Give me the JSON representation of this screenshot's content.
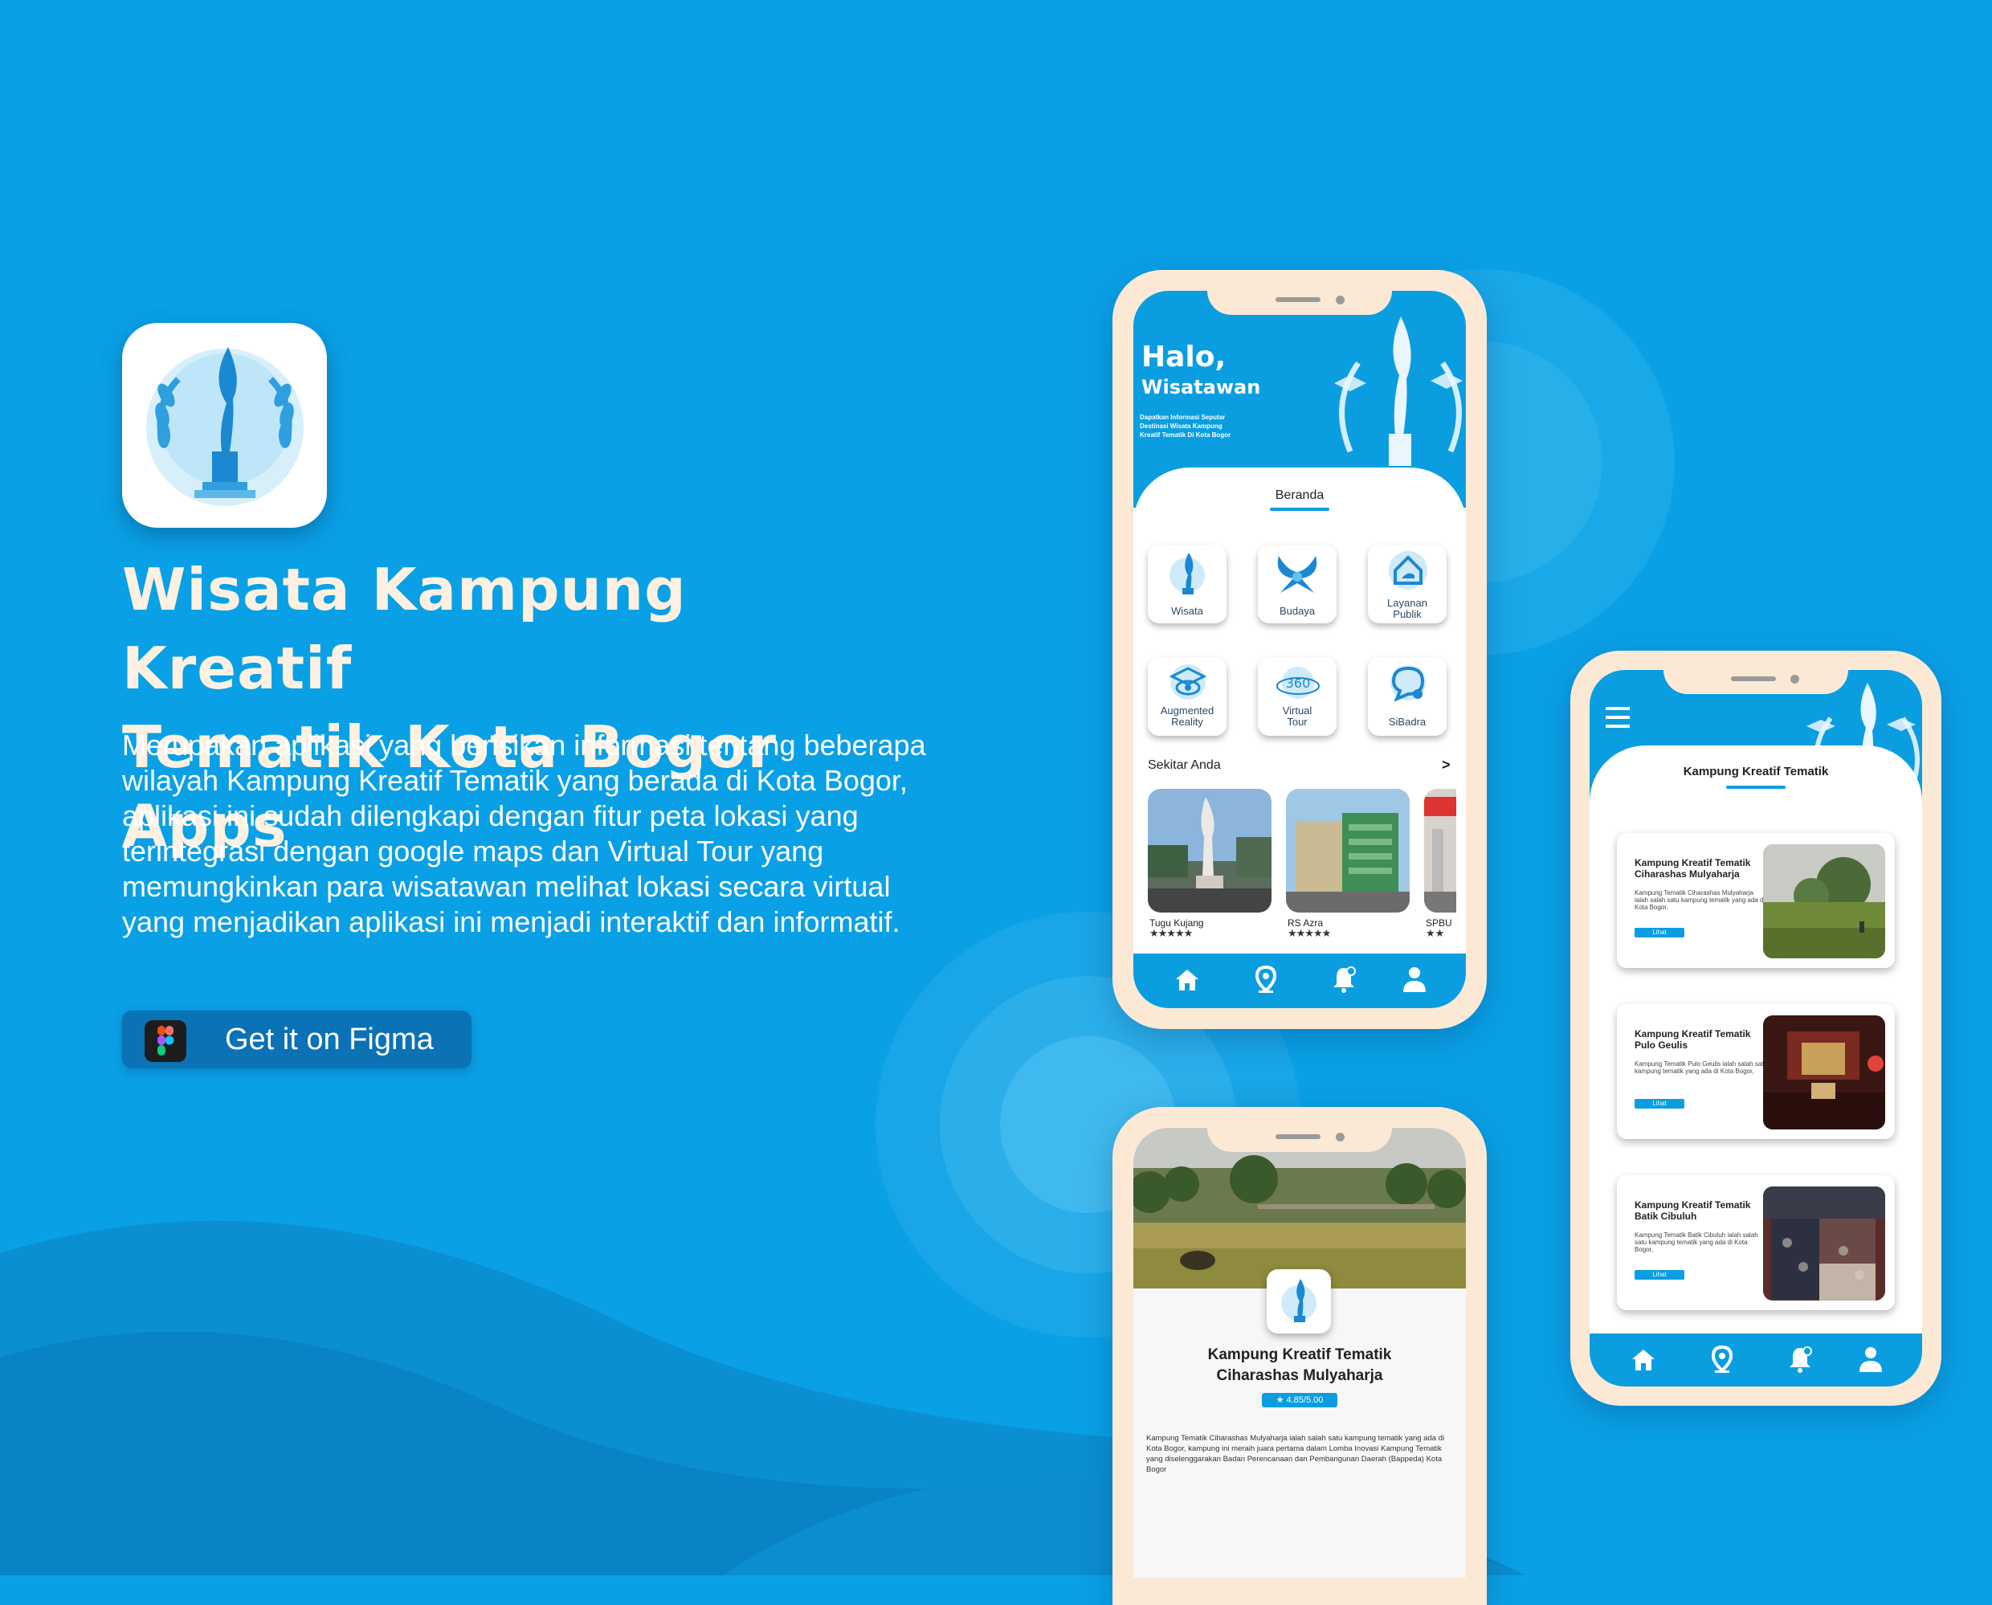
{
  "promo": {
    "headline_line1": "Wisata Kampung Kreatif",
    "headline_line2": "Tematik Kota Bogor Apps",
    "description": "Merupakan aplikasi yang berisikan informasi tentang beberapa wilayah Kampung Kreatif Tematik yang berada di Kota Bogor, aplikasi ini sudah dilengkapi dengan fitur peta lokasi yang terintegrasi dengan google maps dan Virtual Tour yang memungkinkan para wisatawan melihat lokasi secara virtual yang menjadikan aplikasi ini menjadi interaktif dan informatif.",
    "cta_label": "Get it on Figma",
    "cta_icon": "figma-logo-icon"
  },
  "phone_home": {
    "greeting_line1": "Halo,",
    "greeting_line2": "Wisatawan",
    "greeting_sub": "Dapatkan Informasi Seputar Destinasi Wisata Kampung Kreatif Tematik Di Kota Bogor",
    "tab_title": "Beranda",
    "menu": [
      {
        "label": "Wisata",
        "icon": "monument-icon"
      },
      {
        "label": "Budaya",
        "icon": "culture-icon"
      },
      {
        "label": "Layanan Publik",
        "icon": "public-service-icon"
      },
      {
        "label": "Augmented Reality",
        "icon": "ar-icon"
      },
      {
        "label": "Virtual Tour",
        "icon": "360-icon"
      },
      {
        "label": "SiBadra",
        "icon": "chat-icon"
      }
    ],
    "nearby_title": "Sekitar Anda",
    "nearby_more": ">",
    "nearby": [
      {
        "name": "Tugu Kujang",
        "stars": 4,
        "stars_text": "★★★★★"
      },
      {
        "name": "RS Azra",
        "stars": 4,
        "stars_text": "★★★★★"
      },
      {
        "name": "SPBU",
        "stars": 2,
        "stars_text": "★★"
      }
    ]
  },
  "phone_detail": {
    "title_line1": "Kampung Kreatif Tematik",
    "title_line2": "Ciharashas Mulyaharja",
    "rating": "★ 4.85/5.00",
    "body": "Kampung Tematik Ciharashas Mulyaharja ialah salah satu kampung tematik yang ada di Kota Bogor, kampung ini meraih juara pertama dalam Lomba Inovasi Kampung Tematik yang diselenggarakan Badan Perencanaan dan Pembangunan Daerah (Bappeda) Kota Bogor"
  },
  "phone_list": {
    "title": "Kampung Kreatif Tematik",
    "menu_icon": "hamburger-menu-icon",
    "cards": [
      {
        "title": "Kampung Kreatif Tematik Ciharashas Mulyaharja",
        "text": "Kampung Tematik Ciharashas Mulyaharja ialah salah satu kampung tematik yang ada di Kota Bogor,",
        "button": "Lihat"
      },
      {
        "title": "Kampung Kreatif Tematik Pulo Geulis",
        "text": "Kampung Tematik Pulo Geulis ialah salah satu kampung tematik yang ada di Kota Bogor,",
        "button": "Lihat"
      },
      {
        "title": "Kampung Kreatif Tematik Batik Cibuluh",
        "text": "Kampung Tematik Batik Cibuluh ialah salah satu kampung tematik yang ada di Kota Bogor,",
        "button": "Lihat"
      }
    ]
  },
  "tabbar_icons": [
    "home-icon",
    "location-pin-icon",
    "notification-bell-icon",
    "profile-icon"
  ],
  "colors": {
    "background": "#0aa0e6",
    "headline": "#fff1e2",
    "phone_frame": "#fbe9d6",
    "tabbar": "#0a9ee0",
    "button": "#0c72b6"
  }
}
